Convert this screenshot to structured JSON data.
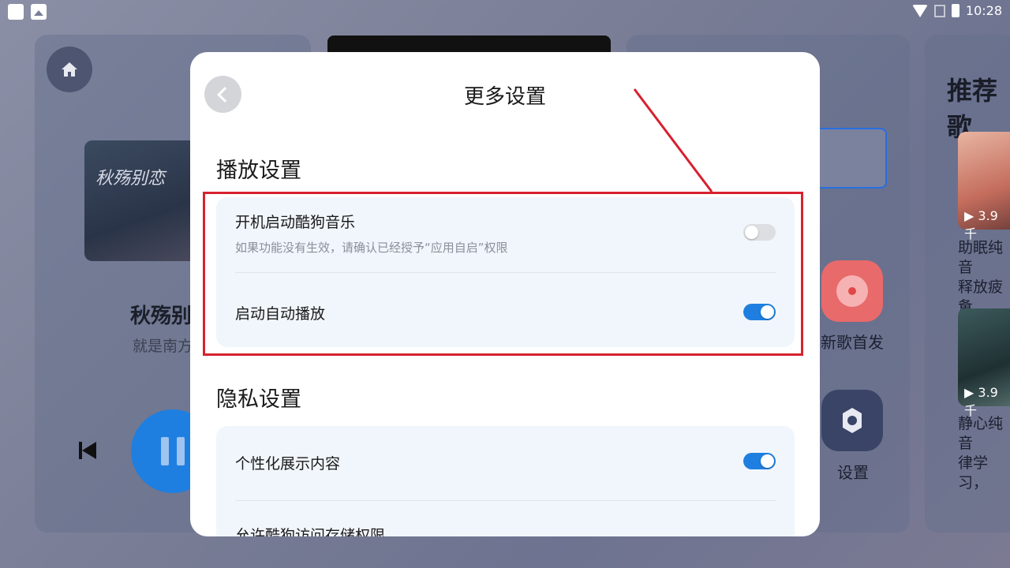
{
  "status_bar": {
    "time": "10:28",
    "icons": [
      "app-icon",
      "image-icon",
      "wifi-icon",
      "no-signal-icon",
      "battery-icon"
    ]
  },
  "background": {
    "player": {
      "song_title": "秋殇别",
      "artist": "就是南方",
      "album_art_text": "秋殇别恋"
    },
    "tiles": [
      {
        "label": "新歌首发",
        "icon": "disc-icon"
      },
      {
        "label": "设置",
        "icon": "gear-icon"
      }
    ],
    "recommend": {
      "title": "推荐歌",
      "items": [
        {
          "play_count": "▶ 3.9千",
          "title_line1": "助眠纯音",
          "title_line2": "释放疲惫"
        },
        {
          "play_count": "▶ 3.9千",
          "title_line1": "静心纯音",
          "title_line2": "律学习，"
        }
      ]
    }
  },
  "dialog": {
    "title": "更多设置",
    "sections": [
      {
        "title": "播放设置",
        "rows": [
          {
            "title": "开机启动酷狗音乐",
            "desc": "如果功能没有生效，请确认已经授予“应用自启”权限",
            "toggle": false
          },
          {
            "title": "启动自动播放",
            "desc": "",
            "toggle": true
          }
        ]
      },
      {
        "title": "隐私设置",
        "rows": [
          {
            "title": "个性化展示内容",
            "desc": "",
            "toggle": true
          },
          {
            "title": "允许酷狗访问存储权限",
            "desc": "",
            "toggle": null
          }
        ]
      }
    ]
  },
  "colors": {
    "accent": "#1f7fe0",
    "highlight": "#d7212f"
  }
}
